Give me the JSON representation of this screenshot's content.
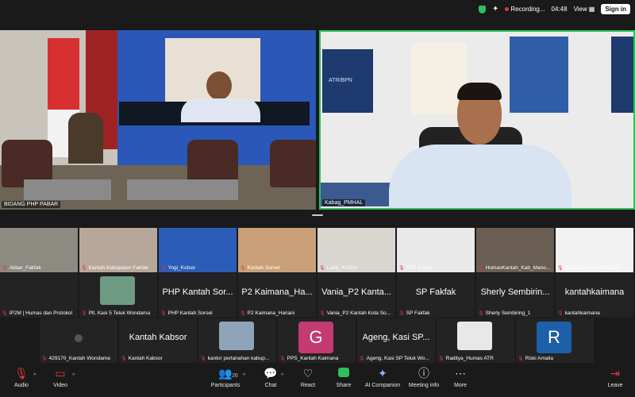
{
  "topbar": {
    "recording_label": "Recording...",
    "timer": "04:48",
    "view_label": "View",
    "signin_label": "Sign in"
  },
  "main": {
    "left_tile_name": "BIDANG PHP PABAR",
    "right_tile_name": "Kabag_PMHAL",
    "poster_text": "ATR/BPN"
  },
  "gallery": {
    "row1": [
      {
        "name": "Akbar_Fakfak",
        "bg": "#8d8a82"
      },
      {
        "name": "Kantah Kabupaten Fakfak",
        "bg": "#b7a79a"
      },
      {
        "name": "Yogi_Kotsor",
        "bg": "#2b5db8"
      },
      {
        "name": "Kantah Sorsel",
        "bg": "#caa079"
      },
      {
        "name": "Leidy_KotSor",
        "bg": "#d9d6d0"
      },
      {
        "name": "PPS Kotsor",
        "bg": "#e9e9e9"
      },
      {
        "name": "HumasKantah_Kab_Mano...",
        "bg": "#6a5e52"
      },
      {
        "name": "KANTAH_MANOKWARI",
        "bg": "#f2f2f2"
      }
    ],
    "row2": [
      {
        "name": "IP2M | Humas dan Protokol",
        "big": ""
      },
      {
        "name": "Plt. Kasi 5 Teluk Wondama",
        "big": ""
      },
      {
        "name": "PHP Kantah Sorsel",
        "big": "PHP Kantah Sor..."
      },
      {
        "name": "P2 Kaimana_Hariani",
        "big": "P2 Kaimana_Ha..."
      },
      {
        "name": "Vania_P2 Kantah Kota So...",
        "big": "Vania_P2 Kanta..."
      },
      {
        "name": "SP Fakfak",
        "big": "SP Fakfak"
      },
      {
        "name": "Sherly Sembiring_1",
        "big": "Sherly Sembirin..."
      },
      {
        "name": "kantahkaimana",
        "big": "kantahkaimana"
      }
    ],
    "row3": [
      {
        "name": "429170_Kantah Wondama",
        "big": ""
      },
      {
        "name": "Kantah Kabsor",
        "big": "Kantah Kabsor"
      },
      {
        "name": "kantor pertanahan kabup...",
        "big": ""
      },
      {
        "name": "PPS_Kantah Kaimana",
        "big": "",
        "letter": "G",
        "letter_bg": "#c43a73"
      },
      {
        "name": "Ageng, Kasi SP Teluk Wo...",
        "big": "Ageng, Kasi SP..."
      },
      {
        "name": "Raditya_Humas ATR",
        "big": ""
      },
      {
        "name": "Riski Amalia",
        "big": "",
        "letter": "R",
        "letter_bg": "#1d5fa8"
      }
    ]
  },
  "toolbar": {
    "audio_label": "Audio",
    "video_label": "Video",
    "participants_label": "Participants",
    "participants_count": "26",
    "chat_label": "Chat",
    "react_label": "React",
    "share_label": "Share",
    "ai_label": "AI Companion",
    "meeting_info_label": "Meeting info",
    "more_label": "More",
    "leave_label": "Leave"
  },
  "colors": {
    "active_speaker": "#2fbf5a",
    "mic_off": "#e0393e",
    "background": "#1a1a1a"
  }
}
